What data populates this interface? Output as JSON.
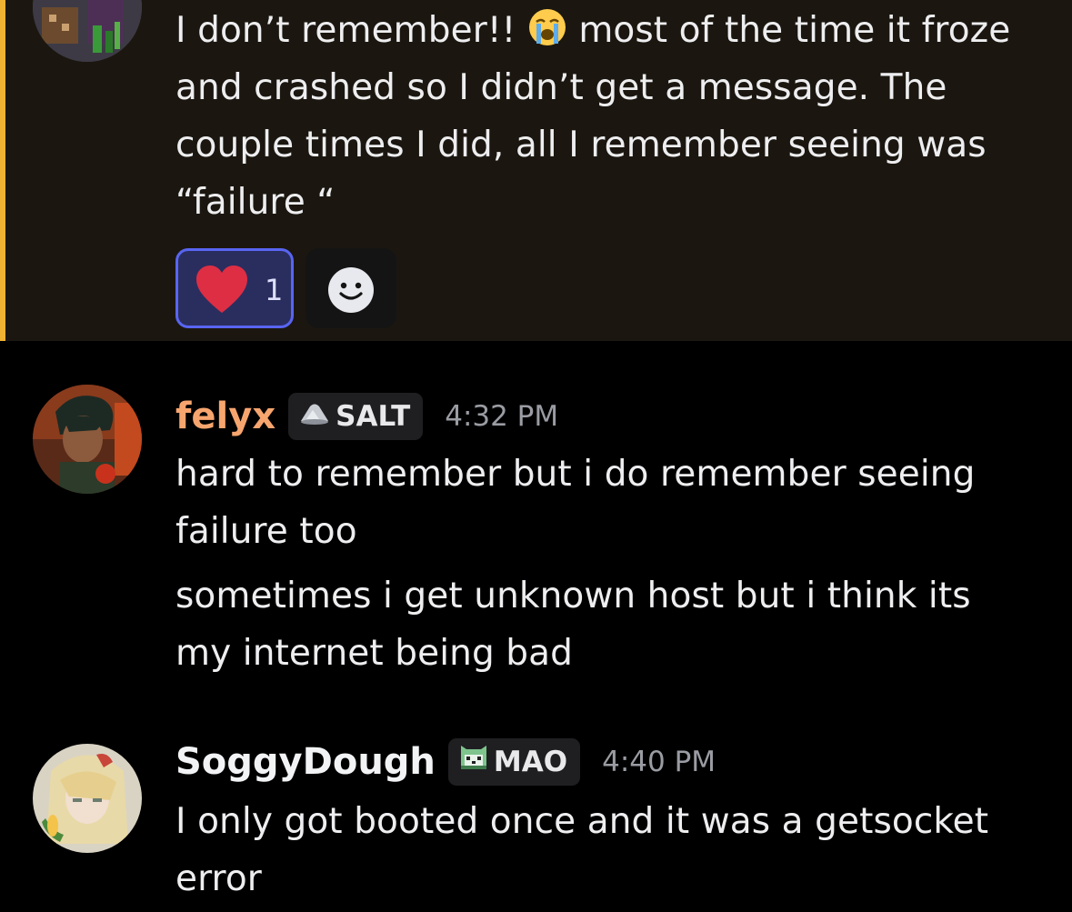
{
  "messages": [
    {
      "lines": [
        "I don’t remember!! [emoji] most of the time it froze",
        "and crashed so I didn’t get a message. The",
        "couple times I did, all I remember seeing was",
        "“failure “"
      ],
      "line1_before": "I don’t remember!!",
      "line1_after": " most of the time it froze",
      "rest": "and crashed so I didn’t get a message. The\ncouple times I did, all I remember seeing was\n“failure “",
      "inline_emoji": "loudly-crying-face",
      "reactions": [
        {
          "emoji": "heart",
          "count": "1",
          "active": true
        }
      ],
      "add_reaction_icon": "smile-icon",
      "highlighted": true
    },
    {
      "username": "felyx",
      "username_color": "#f7a56e",
      "tag_icon": "salt-icon",
      "tag": "SALT",
      "timestamp": "4:32 PM",
      "text1": "hard to remember but i do remember seeing\nfailure too",
      "text2": "sometimes i get unknown host but i think its\nmy internet being bad"
    },
    {
      "username": "SoggyDough",
      "username_color": "#f2f3f5",
      "tag_icon": "cat-icon",
      "tag": "MAO",
      "timestamp": "4:40 PM",
      "text1": "I only got booted once and it was a getsocket\nerror"
    }
  ],
  "colors": {
    "background": "#000000",
    "highlight_bg": "#1b1710",
    "highlight_bar": "#f0b232",
    "reaction_active_bg": "#2a2e5e",
    "reaction_active_border": "#5865f2"
  }
}
